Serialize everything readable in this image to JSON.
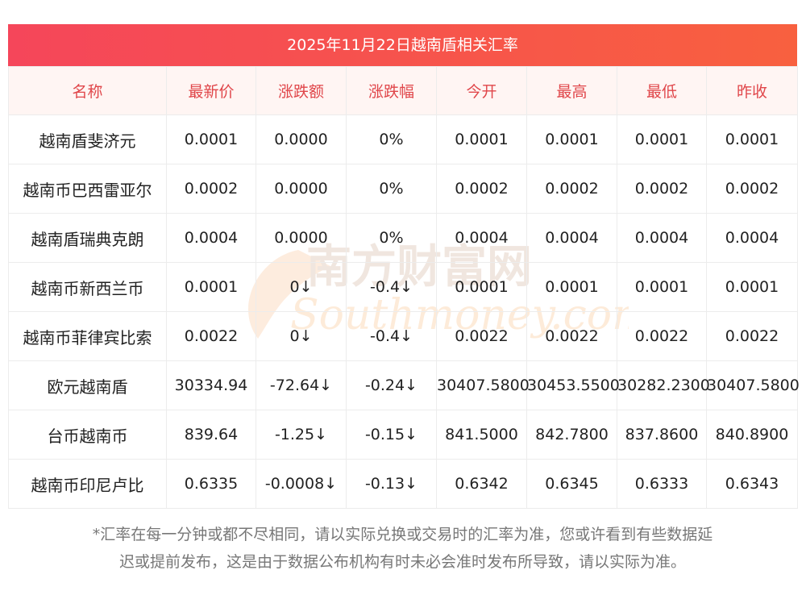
{
  "title": "2025年11月22日越南盾相关汇率",
  "watermark": {
    "cn": "南方财富网",
    "en": "Southmoney.com"
  },
  "columns": [
    "名称",
    "最新价",
    "涨跌额",
    "涨跌幅",
    "今开",
    "最高",
    "最低",
    "昨收"
  ],
  "rows": [
    {
      "name": "越南盾斐济元",
      "latest": "0.0001",
      "change": "0.0000",
      "pct": "0%",
      "open": "0.0001",
      "high": "0.0001",
      "low": "0.0001",
      "prev": "0.0001",
      "down": false
    },
    {
      "name": "越南币巴西雷亚尔",
      "latest": "0.0002",
      "change": "0.0000",
      "pct": "0%",
      "open": "0.0002",
      "high": "0.0002",
      "low": "0.0002",
      "prev": "0.0002",
      "down": false
    },
    {
      "name": "越南盾瑞典克朗",
      "latest": "0.0004",
      "change": "0.0000",
      "pct": "0%",
      "open": "0.0004",
      "high": "0.0004",
      "low": "0.0004",
      "prev": "0.0004",
      "down": false
    },
    {
      "name": "越南币新西兰币",
      "latest": "0.0001",
      "change": "0↓",
      "pct": "-0.4↓",
      "open": "0.0001",
      "high": "0.0001",
      "low": "0.0001",
      "prev": "0.0001",
      "down": true
    },
    {
      "name": "越南币菲律宾比索",
      "latest": "0.0022",
      "change": "0↓",
      "pct": "-0.4↓",
      "open": "0.0022",
      "high": "0.0022",
      "low": "0.0022",
      "prev": "0.0022",
      "down": true
    },
    {
      "name": "欧元越南盾",
      "latest": "30334.94",
      "change": "-72.64↓",
      "pct": "-0.24↓",
      "open": "30407.5800",
      "high": "30453.5500",
      "low": "30282.2300",
      "prev": "30407.5800",
      "down": true
    },
    {
      "name": "台币越南币",
      "latest": "839.64",
      "change": "-1.25↓",
      "pct": "-0.15↓",
      "open": "841.5000",
      "high": "842.7800",
      "low": "837.8600",
      "prev": "840.8900",
      "down": true
    },
    {
      "name": "越南币印尼卢比",
      "latest": "0.6335",
      "change": "-0.0008↓",
      "pct": "-0.13↓",
      "open": "0.6342",
      "high": "0.6345",
      "low": "0.6333",
      "prev": "0.6343",
      "down": true
    }
  ],
  "footnote_line1": "*汇率在每一分钟或都不尽相同，请以实际兑换或交易时的汇率为准，您或许看到有些数据延",
  "footnote_line2": "迟或提前发布，这是由于数据公布机构有时未必会准时发布所导致，请以实际为准。",
  "colors": {
    "header_text": "#e0464a",
    "down": "#1a8a2c",
    "title_start": "#f5465a",
    "title_end": "#f8603f"
  }
}
